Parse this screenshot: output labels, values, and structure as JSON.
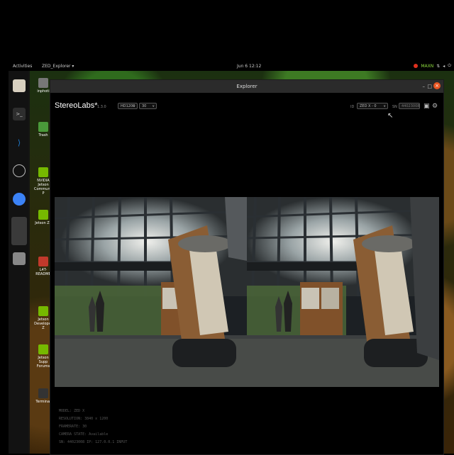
{
  "topbar": {
    "activities": "Activities",
    "app_menu": "ZED_Explorer ▾",
    "clock": "Jun 6  12:12",
    "power_mode": "MAXN",
    "tray_icons": [
      "network-icon",
      "volume-icon",
      "power-icon"
    ]
  },
  "dock": {
    "items": [
      {
        "name": "files-icon",
        "color": "#d8d0c0"
      },
      {
        "name": "terminal-icon",
        "color": "#2e2e2e"
      },
      {
        "name": "vscode-icon",
        "color": "#1e7fd6"
      },
      {
        "name": "obs-icon",
        "color": "#222222"
      },
      {
        "name": "chromium-icon",
        "color": "#3b82f6"
      },
      {
        "name": "app-icon",
        "color": "#444444"
      },
      {
        "name": "drive-icon",
        "color": "#888888"
      }
    ]
  },
  "desktop_icons": [
    {
      "label": "inphoti",
      "color": "#777777"
    },
    {
      "label": "Trash",
      "color": "#4a9a3a"
    },
    {
      "label": "NVIDIA Jetson Community P",
      "color": "#76b900"
    },
    {
      "label": "Jetson Zo",
      "color": "#76b900"
    },
    {
      "label": "L4T-README",
      "color": "#c0392b"
    },
    {
      "label": "Jetson Developer Z",
      "color": "#76b900"
    },
    {
      "label": "Jetson Supp Forums",
      "color": "#76b900"
    },
    {
      "label": "Terminal",
      "color": "#333333"
    }
  ],
  "window": {
    "title": "Explorer",
    "brand": "StereoLabs*",
    "version": "1.3.0",
    "resolution": "HD1200",
    "fps": "30",
    "id_label": "ID",
    "camera_select": "ZED X - 0",
    "sn_label": "SN",
    "serial_placeholder": "44023008",
    "accent": "#e95420"
  },
  "info_lines": [
    "MODEL: ZED X",
    "RESOLUTION: 3840 x 1200",
    "FRAMERATE: 30",
    "CAMERA STATE: Available",
    "SN: 44023008  IP: 127.0.0.1 INPUT"
  ]
}
